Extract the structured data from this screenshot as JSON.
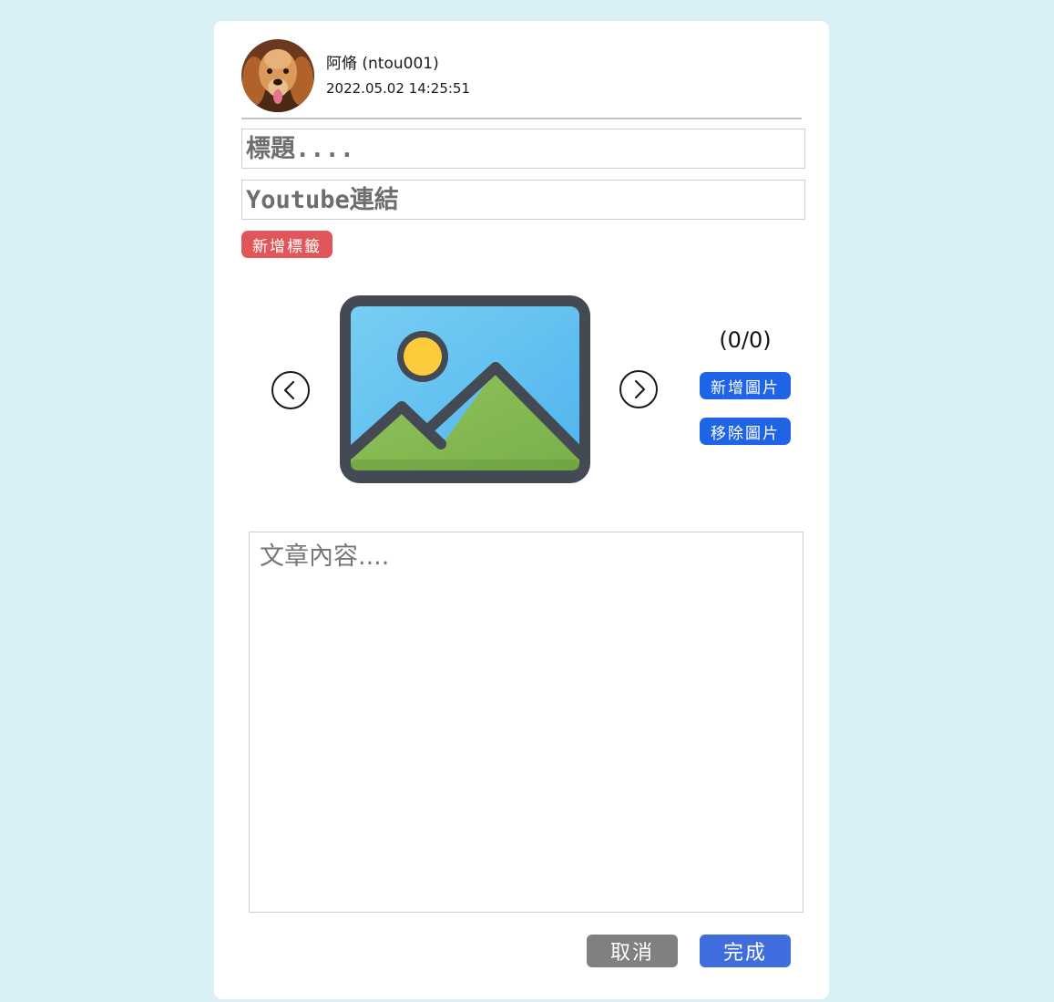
{
  "post_header": {
    "username": "阿脩 (ntou001)",
    "timestamp": "2022.05.02 14:25:51"
  },
  "form": {
    "title_placeholder": "標題....",
    "youtube_placeholder": "Youtube連結",
    "add_tag_label": "新增標籤",
    "content_placeholder": "文章內容...."
  },
  "image_gallery": {
    "counter": "(0/0)",
    "add_image_label": "新增圖片",
    "remove_image_label": "移除圖片",
    "prev_icon": "chevron-left-circle-icon",
    "next_icon": "chevron-right-circle-icon",
    "placeholder_icon": "image-placeholder-icon"
  },
  "actions": {
    "cancel_label": "取消",
    "done_label": "完成"
  },
  "colors": {
    "page_background": "#d9f0f6",
    "tag_button": "#e15759",
    "image_buttons": "#1f63e6",
    "cancel_button": "#808080",
    "done_button": "#3f6ddd"
  }
}
